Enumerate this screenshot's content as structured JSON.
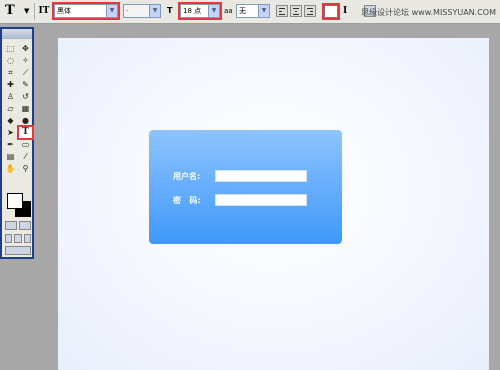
{
  "options_bar": {
    "tool_glyph": "T",
    "orientation_glyph": "IT",
    "font_family": "黑体",
    "font_style": "-",
    "size_glyph": "T",
    "font_size": "18 点",
    "aa_glyph": "aa",
    "anti_alias": "无",
    "warp_glyph": "I",
    "watermark": "思缘设计论坛 www.MISSYUAN.COM"
  },
  "toolbox": {
    "text_tool": "T"
  },
  "login": {
    "username_label": "用户名:",
    "password_label": "密   码:",
    "username_value": "",
    "password_value": ""
  },
  "colors": {
    "highlight": "#e03a3a",
    "panel_top": "#8ec3ff",
    "panel_bottom": "#3f99f8",
    "toolbox_border": "#1e3d8c"
  }
}
